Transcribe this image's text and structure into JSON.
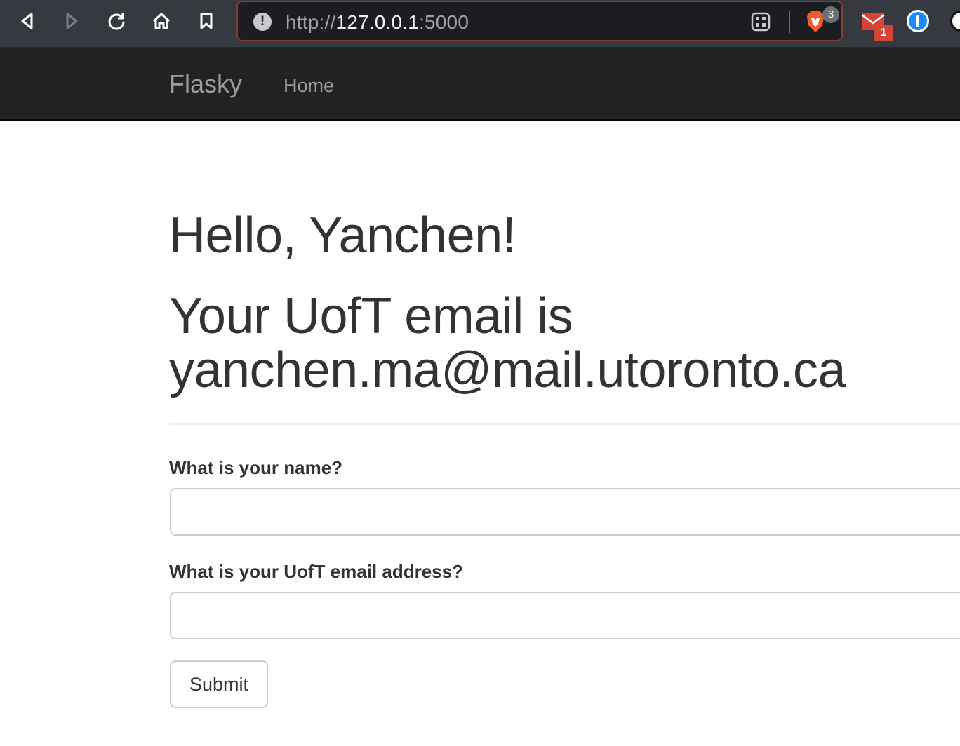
{
  "browser": {
    "url_scheme": "http://",
    "url_host": "127.0.0.1",
    "url_port": ":5000",
    "brave_shield_count": "3",
    "mail_badge_count": "1",
    "accent_border": "#8a3b31"
  },
  "navbar": {
    "brand": "Flasky",
    "links": [
      {
        "label": "Home"
      }
    ]
  },
  "main": {
    "greeting": "Hello, Yanchen!",
    "email_line_1": "Your UofT email is",
    "email_line_2": "yanchen.ma@mail.utoronto.ca",
    "form": {
      "name_label": "What is your name?",
      "name_value": "",
      "email_label": "What is your UofT email address?",
      "email_value": "",
      "submit_label": "Submit"
    }
  }
}
